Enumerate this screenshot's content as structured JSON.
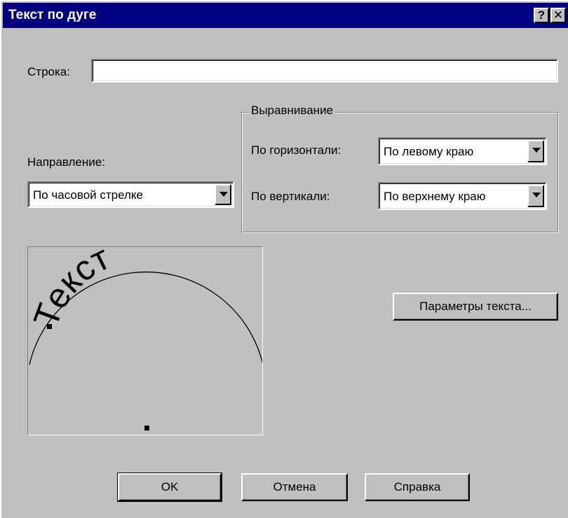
{
  "window": {
    "title": "Текст по дуге",
    "help_button": "?",
    "close_button": "✕"
  },
  "string_field": {
    "label": "Строка:",
    "value": ""
  },
  "direction": {
    "label": "Направление:",
    "selected": "По часовой стрелке"
  },
  "alignment": {
    "group_title": "Выравнивание",
    "horizontal_label": "По горизонтали:",
    "horizontal_selected": "По левому краю",
    "vertical_label": "По вертикали:",
    "vertical_selected": "По верхнему краю"
  },
  "preview": {
    "sample_text": "Текст"
  },
  "buttons": {
    "text_params": "Параметры текста...",
    "ok": "OK",
    "cancel": "Отмена",
    "help": "Справка"
  }
}
